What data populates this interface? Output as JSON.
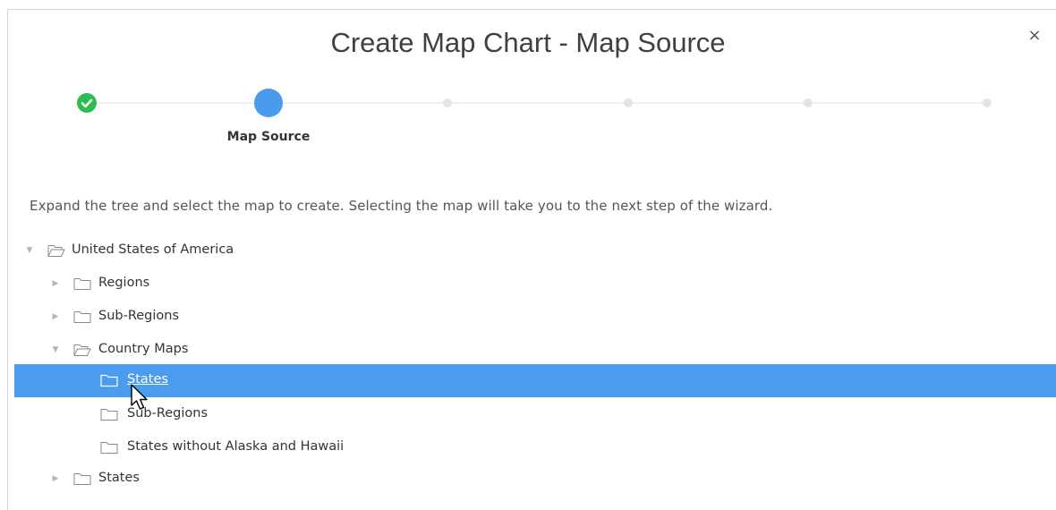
{
  "dialog": {
    "title": "Create Map Chart - Map Source",
    "close_label": "×"
  },
  "wizard": {
    "current_step_label": "Map Source",
    "steps": [
      {
        "state": "complete"
      },
      {
        "state": "current"
      },
      {
        "state": "future"
      },
      {
        "state": "future"
      },
      {
        "state": "future"
      },
      {
        "state": "future"
      }
    ],
    "colors": {
      "complete": "#2ebb50",
      "current": "#4b9bec",
      "future": "#e4e4e4"
    }
  },
  "instructions": "Expand the tree and select the map to create. Selecting the map will take you to the next step of the wizard.",
  "tree": {
    "nodes": [
      {
        "label": "United States of America",
        "expanded": true,
        "level": 0
      },
      {
        "label": "Regions",
        "expanded": false,
        "level": 1
      },
      {
        "label": "Sub-Regions",
        "expanded": false,
        "level": 1
      },
      {
        "label": "Country Maps",
        "expanded": true,
        "level": 1
      },
      {
        "label": "States",
        "leaf": true,
        "selected": true,
        "level": 2
      },
      {
        "label": "Sub-Regions",
        "leaf": true,
        "level": 2
      },
      {
        "label": "States without Alaska and Hawaii",
        "leaf": true,
        "level": 2
      },
      {
        "label": "States",
        "expanded": false,
        "level": 1
      }
    ],
    "selection_color": "#4a9cef"
  }
}
